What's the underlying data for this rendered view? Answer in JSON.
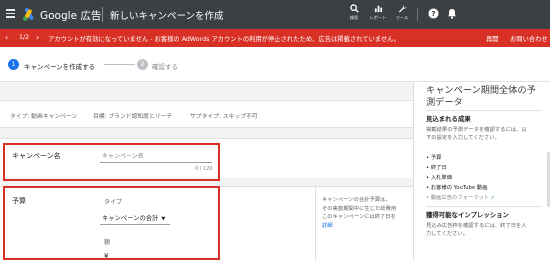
{
  "header": {
    "brand": "Google 広告",
    "page_title": "新しいキャンペーンを作成",
    "tools": [
      {
        "label": "検索",
        "icon": "search-icon"
      },
      {
        "label": "レポート",
        "icon": "report-icon"
      },
      {
        "label": "ツール",
        "icon": "wrench-icon"
      }
    ],
    "help_icon": "help-icon",
    "bell_icon": "notification-bell-icon"
  },
  "alert": {
    "pager": "1/2",
    "message": "アカウントが有効になっていません - お客様の AdWords アカウントの利用が停止されたため、広告は掲載されていません。",
    "actions": [
      "再開",
      "お問い合わせ"
    ],
    "color": "#d93025"
  },
  "steps": [
    {
      "number": "1",
      "label": "キャンペーンを作成する",
      "color": "#1a73e8"
    },
    {
      "number": "2",
      "label": "確認する",
      "color": "#bdc1c6"
    }
  ],
  "summary": {
    "type": "タイプ: 動画キャンペーン",
    "goal": "目標: ブランド認知度とリーチ",
    "subtype": "サブタイプ: スキップ不可"
  },
  "campaign_name": {
    "title": "キャンペーン名",
    "placeholder": "キャンペーン名",
    "counter": "0 / 120"
  },
  "budget": {
    "title": "予算",
    "type_label": "タイプ",
    "type_value": "キャンペーンの合計",
    "amount_label": "額",
    "currency": "¥",
    "note_lines": [
      "キャンペーンの合計予算は、",
      "その実施期間中に生じた総費用",
      "このキャンペーンには終了日を",
      "詳細"
    ]
  },
  "panel": {
    "title": "キャンペーン期間全体の予測データ",
    "forecast_heading": "見込まれる成果",
    "forecast_desc_lines": [
      "掲載結果の予測データを確認するには、以",
      "下の設定を入力してください。"
    ],
    "checklist": [
      {
        "text": "予算",
        "done": false
      },
      {
        "text": "終了日",
        "done": false
      },
      {
        "text": "入札単価",
        "done": false
      },
      {
        "text": "お客様の YouTube 動画",
        "done": false
      },
      {
        "text": "動画広告のフォーマット",
        "done": true
      }
    ],
    "impressions_heading": "獲得可能なインプレッション",
    "impressions_desc_lines": [
      "見込み広告枠を確認するには、終了日を入",
      "力してください。"
    ]
  },
  "highlight_color": "#d93025"
}
